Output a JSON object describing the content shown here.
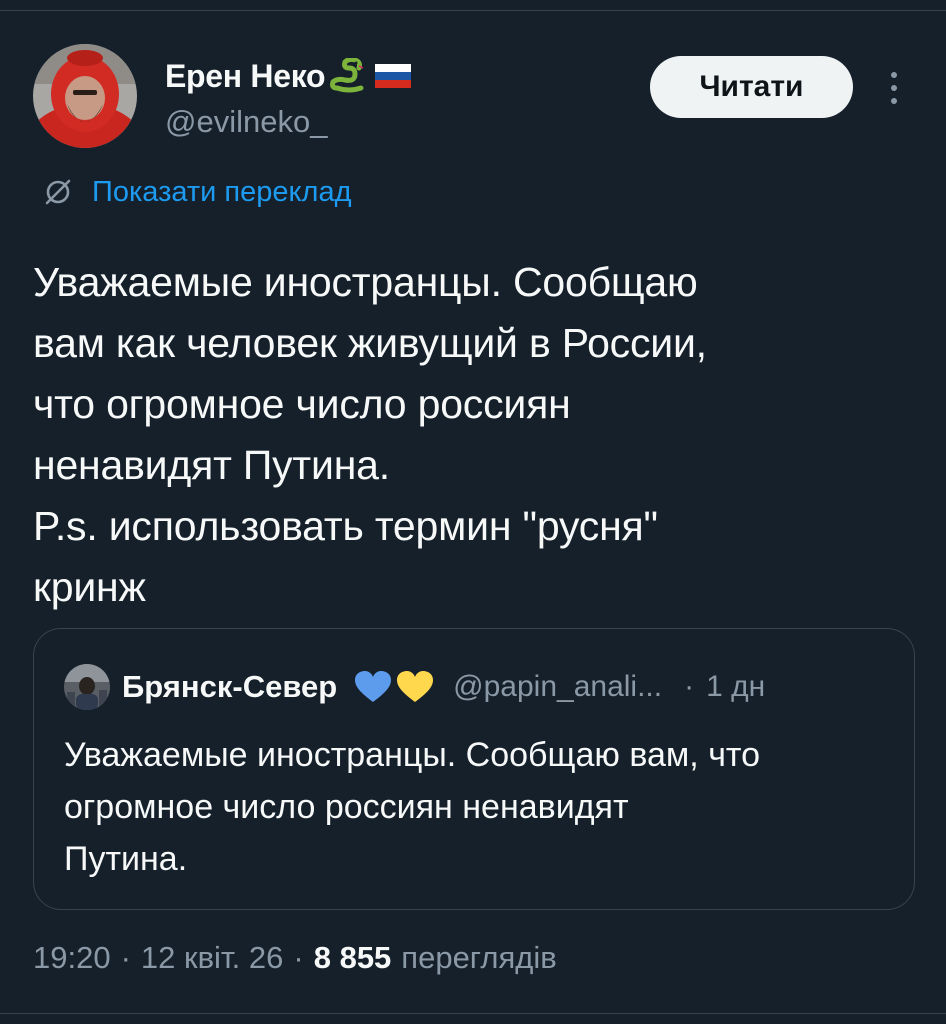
{
  "author": {
    "display_name": "Ерен Неко",
    "handle": "@evilneko_",
    "badges": [
      "snake-emoji-icon",
      "russian-flag-icon"
    ]
  },
  "follow_button": {
    "label": "Читати"
  },
  "more_menu": {
    "icon": "more-vertical-icon"
  },
  "translate": {
    "label": "Показати переклад",
    "icon": "translate-icon"
  },
  "tweet": {
    "text": "Уважаемые иностранцы. Сообщаю\nвам как человек живущий в России,\nчто огромное число россиян\nненавидят Путина.\nP.s. использовать термин \"русня\"\nкринж"
  },
  "quote": {
    "display_name": "Брянск-Север",
    "badges": [
      "blue-heart-icon",
      "yellow-heart-icon"
    ],
    "handle": "@papin_anali...",
    "separator": "·",
    "time": "1 дн",
    "text": "Уважаемые иностранцы. Сообщаю вам, что\nогромное число россиян ненавидят\nПутина."
  },
  "meta": {
    "time": "19:20",
    "sep1": "·",
    "date": "12 квіт. 26",
    "sep2": "·",
    "views_count": "8 855",
    "views_label": "переглядів"
  },
  "colors": {
    "background": "#15202b",
    "text": "#f7f9f9",
    "secondary": "#8b98a5",
    "accent": "#1d9bf0",
    "border": "#38444d",
    "button_bg": "#eff3f4"
  }
}
